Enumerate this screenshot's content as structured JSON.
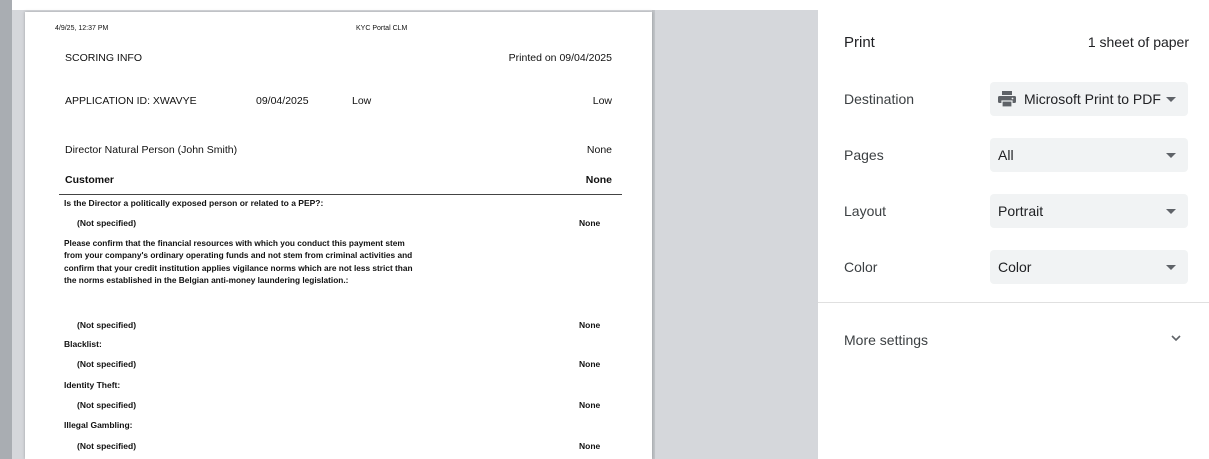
{
  "preview": {
    "header_date": "4/9/25, 12:37 PM",
    "header_title": "KYC Portal CLM",
    "scoring_title": "SCORING INFO",
    "printed_on": "Printed on 09/04/2025",
    "application_id": "APPLICATION ID: XWAVYE",
    "application_date": "09/04/2025",
    "risk_1": "Low",
    "risk_2": "Low",
    "director_label": "Director Natural Person (John Smith)",
    "director_value": "None",
    "customer_label": "Customer",
    "customer_value": "None",
    "q_pep": "Is the Director a politically exposed person or related to a PEP?:",
    "not_specified": "(Not specified)",
    "none": "None",
    "q_funds": "Please confirm that the financial resources with which you conduct this payment stem from your company's ordinary operating funds and not stem from criminal activities and confirm that your credit institution applies vigilance norms which are not less strict than the norms established in the Belgian anti-money laundering legislation.:",
    "q_blacklist": "Blacklist:",
    "q_identity": "Identity Theft:",
    "q_gambling": "Illegal Gambling:"
  },
  "settings": {
    "title": "Print",
    "sheets": "1 sheet of paper",
    "destination_label": "Destination",
    "destination_value": "Microsoft Print to PDF",
    "destination_icon": "printer-icon",
    "pages_label": "Pages",
    "pages_value": "All",
    "layout_label": "Layout",
    "layout_value": "Portrait",
    "color_label": "Color",
    "color_value": "Color",
    "more_settings": "More settings",
    "more_icon": "chevron-down-icon"
  },
  "colors": {
    "accent": "#1a73e8",
    "preview_bg": "#d5d7db",
    "select_bg": "#f1f3f4"
  }
}
